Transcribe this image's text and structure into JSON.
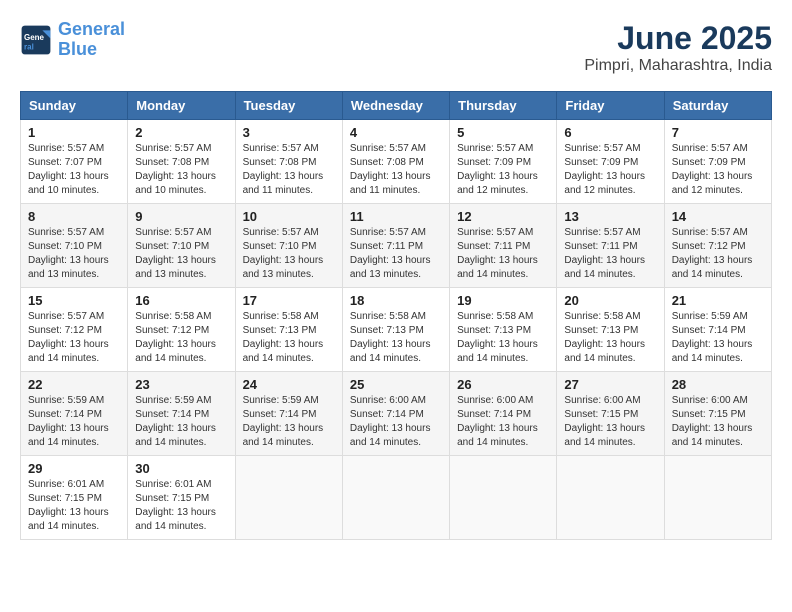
{
  "logo": {
    "line1": "General",
    "line2": "Blue"
  },
  "title": "June 2025",
  "subtitle": "Pimpri, Maharashtra, India",
  "headers": [
    "Sunday",
    "Monday",
    "Tuesday",
    "Wednesday",
    "Thursday",
    "Friday",
    "Saturday"
  ],
  "weeks": [
    [
      {
        "day": "1",
        "info": "Sunrise: 5:57 AM\nSunset: 7:07 PM\nDaylight: 13 hours\nand 10 minutes."
      },
      {
        "day": "2",
        "info": "Sunrise: 5:57 AM\nSunset: 7:08 PM\nDaylight: 13 hours\nand 10 minutes."
      },
      {
        "day": "3",
        "info": "Sunrise: 5:57 AM\nSunset: 7:08 PM\nDaylight: 13 hours\nand 11 minutes."
      },
      {
        "day": "4",
        "info": "Sunrise: 5:57 AM\nSunset: 7:08 PM\nDaylight: 13 hours\nand 11 minutes."
      },
      {
        "day": "5",
        "info": "Sunrise: 5:57 AM\nSunset: 7:09 PM\nDaylight: 13 hours\nand 12 minutes."
      },
      {
        "day": "6",
        "info": "Sunrise: 5:57 AM\nSunset: 7:09 PM\nDaylight: 13 hours\nand 12 minutes."
      },
      {
        "day": "7",
        "info": "Sunrise: 5:57 AM\nSunset: 7:09 PM\nDaylight: 13 hours\nand 12 minutes."
      }
    ],
    [
      {
        "day": "8",
        "info": "Sunrise: 5:57 AM\nSunset: 7:10 PM\nDaylight: 13 hours\nand 13 minutes."
      },
      {
        "day": "9",
        "info": "Sunrise: 5:57 AM\nSunset: 7:10 PM\nDaylight: 13 hours\nand 13 minutes."
      },
      {
        "day": "10",
        "info": "Sunrise: 5:57 AM\nSunset: 7:10 PM\nDaylight: 13 hours\nand 13 minutes."
      },
      {
        "day": "11",
        "info": "Sunrise: 5:57 AM\nSunset: 7:11 PM\nDaylight: 13 hours\nand 13 minutes."
      },
      {
        "day": "12",
        "info": "Sunrise: 5:57 AM\nSunset: 7:11 PM\nDaylight: 13 hours\nand 14 minutes."
      },
      {
        "day": "13",
        "info": "Sunrise: 5:57 AM\nSunset: 7:11 PM\nDaylight: 13 hours\nand 14 minutes."
      },
      {
        "day": "14",
        "info": "Sunrise: 5:57 AM\nSunset: 7:12 PM\nDaylight: 13 hours\nand 14 minutes."
      }
    ],
    [
      {
        "day": "15",
        "info": "Sunrise: 5:57 AM\nSunset: 7:12 PM\nDaylight: 13 hours\nand 14 minutes."
      },
      {
        "day": "16",
        "info": "Sunrise: 5:58 AM\nSunset: 7:12 PM\nDaylight: 13 hours\nand 14 minutes."
      },
      {
        "day": "17",
        "info": "Sunrise: 5:58 AM\nSunset: 7:13 PM\nDaylight: 13 hours\nand 14 minutes."
      },
      {
        "day": "18",
        "info": "Sunrise: 5:58 AM\nSunset: 7:13 PM\nDaylight: 13 hours\nand 14 minutes."
      },
      {
        "day": "19",
        "info": "Sunrise: 5:58 AM\nSunset: 7:13 PM\nDaylight: 13 hours\nand 14 minutes."
      },
      {
        "day": "20",
        "info": "Sunrise: 5:58 AM\nSunset: 7:13 PM\nDaylight: 13 hours\nand 14 minutes."
      },
      {
        "day": "21",
        "info": "Sunrise: 5:59 AM\nSunset: 7:14 PM\nDaylight: 13 hours\nand 14 minutes."
      }
    ],
    [
      {
        "day": "22",
        "info": "Sunrise: 5:59 AM\nSunset: 7:14 PM\nDaylight: 13 hours\nand 14 minutes."
      },
      {
        "day": "23",
        "info": "Sunrise: 5:59 AM\nSunset: 7:14 PM\nDaylight: 13 hours\nand 14 minutes."
      },
      {
        "day": "24",
        "info": "Sunrise: 5:59 AM\nSunset: 7:14 PM\nDaylight: 13 hours\nand 14 minutes."
      },
      {
        "day": "25",
        "info": "Sunrise: 6:00 AM\nSunset: 7:14 PM\nDaylight: 13 hours\nand 14 minutes."
      },
      {
        "day": "26",
        "info": "Sunrise: 6:00 AM\nSunset: 7:14 PM\nDaylight: 13 hours\nand 14 minutes."
      },
      {
        "day": "27",
        "info": "Sunrise: 6:00 AM\nSunset: 7:15 PM\nDaylight: 13 hours\nand 14 minutes."
      },
      {
        "day": "28",
        "info": "Sunrise: 6:00 AM\nSunset: 7:15 PM\nDaylight: 13 hours\nand 14 minutes."
      }
    ],
    [
      {
        "day": "29",
        "info": "Sunrise: 6:01 AM\nSunset: 7:15 PM\nDaylight: 13 hours\nand 14 minutes."
      },
      {
        "day": "30",
        "info": "Sunrise: 6:01 AM\nSunset: 7:15 PM\nDaylight: 13 hours\nand 14 minutes."
      },
      {
        "day": "",
        "info": ""
      },
      {
        "day": "",
        "info": ""
      },
      {
        "day": "",
        "info": ""
      },
      {
        "day": "",
        "info": ""
      },
      {
        "day": "",
        "info": ""
      }
    ]
  ]
}
